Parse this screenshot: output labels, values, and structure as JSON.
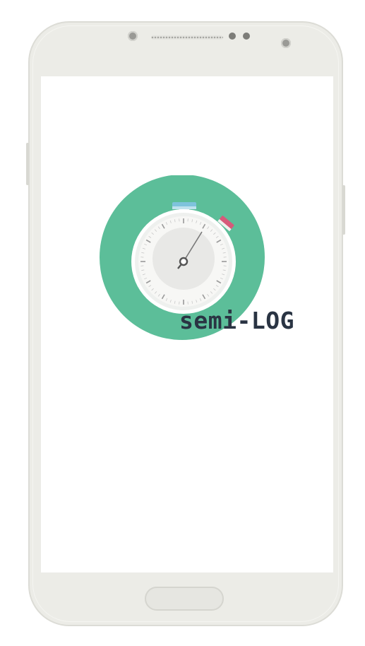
{
  "app": {
    "name": "semi-LOG"
  },
  "logo": {
    "icon": "stopwatch-icon",
    "background_color": "#5cbe99",
    "face_color": "#f2f2f0",
    "crown_color": "#7ec3dc",
    "side_button_color": "#d65a7a",
    "needle_color": "#555555"
  },
  "device": {
    "frame_color": "#ecece7",
    "screen_color": "#ffffff"
  }
}
